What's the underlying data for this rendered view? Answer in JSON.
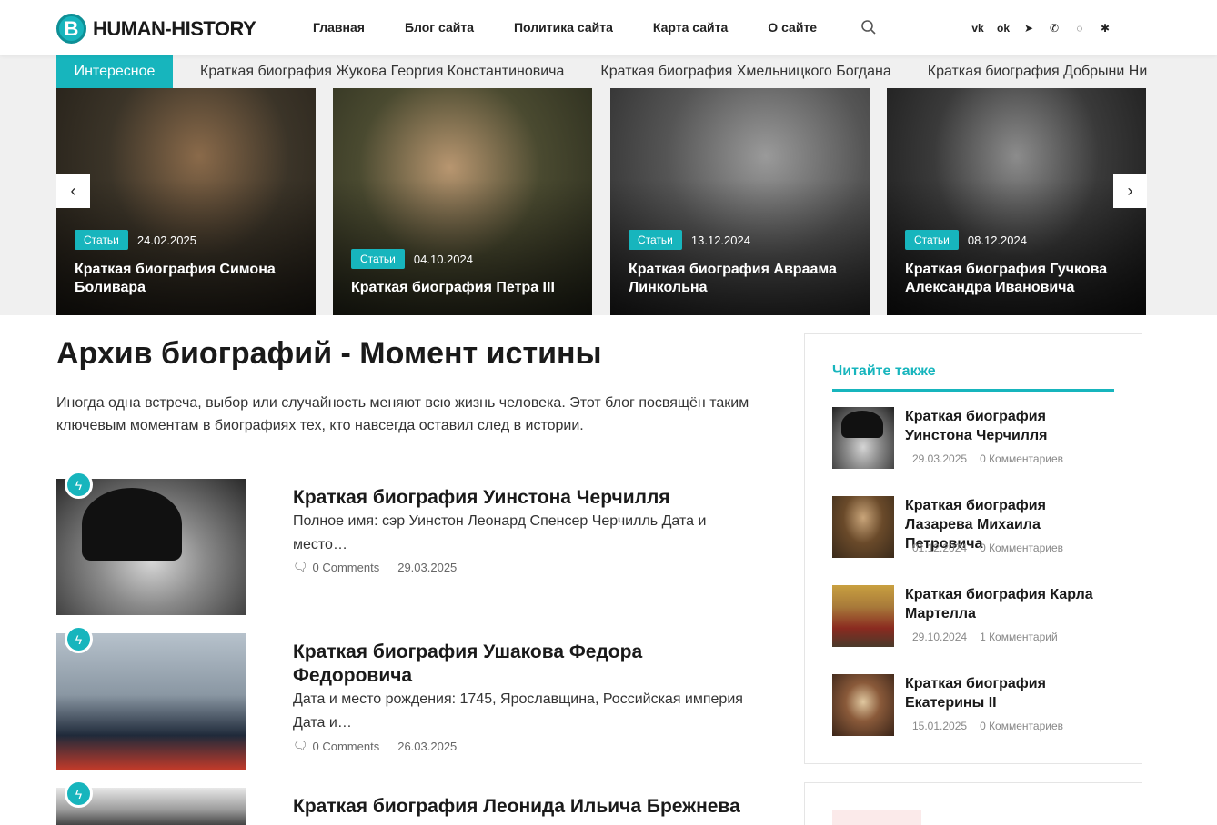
{
  "header": {
    "logo_mark": "B",
    "logo_text": "HUMAN-HISTORY",
    "nav": [
      "Главная",
      "Блог сайта",
      "Политика сайта",
      "Карта сайта",
      "О сайте"
    ],
    "social_icons": [
      "vk-icon",
      "ok-icon",
      "telegram-icon",
      "viber-icon",
      "whatsapp-icon",
      "zen-icon"
    ]
  },
  "ticker": {
    "label": "Интересное",
    "items": [
      "Краткая биография Жукова Георгия Константиновича",
      "Краткая биография Хмельницкого Богдана",
      "Краткая биография Добрыни Никитича"
    ]
  },
  "slider": {
    "prev": "‹",
    "next": "›",
    "slides": [
      {
        "badge": "Статьи",
        "date": "24.02.2025",
        "title": "Краткая биография Симона Боливара",
        "bg": "#3b3428"
      },
      {
        "badge": "Статьи",
        "date": "04.10.2024",
        "title": "Краткая биография Петра III",
        "bg": "#4a4a30"
      },
      {
        "badge": "Статьи",
        "date": "13.12.2024",
        "title": "Краткая биография Авраама Линкольна",
        "bg": "#555555"
      },
      {
        "badge": "Статьи",
        "date": "08.12.2024",
        "title": "Краткая биография Гучкова Александра Ивановича",
        "bg": "#2e2e2e"
      }
    ]
  },
  "main": {
    "title": "Архив биографий - Момент истины",
    "intro": "Иногда одна встреча, выбор или случайность меняют всю жизнь человека. Этот блог посвящён таким ключевым моментам в биографиях тех, кто навсегда оставил след в истории.",
    "posts": [
      {
        "title": "Краткая биография Уинстона Черчилля",
        "excerpt": "Полное имя: сэр Уинстон Леонард Спенсер Черчилль Дата и место…",
        "comments": "0 Comments",
        "date": "29.03.2025"
      },
      {
        "title": "Краткая биография Ушакова Федора Федоровича",
        "excerpt": "Дата и место рождения: 1745, Ярославщина, Российская империя Дата и…",
        "comments": "0 Comments",
        "date": "26.03.2025"
      },
      {
        "title": "Краткая биография Леонида Ильича Брежнева",
        "excerpt": "",
        "comments": "",
        "date": ""
      }
    ]
  },
  "sidebar": {
    "heading": "Читайте также",
    "items": [
      {
        "title": "Краткая биография Уинстона Черчилля",
        "date": "29.03.2025",
        "comments": "0 Комментариев"
      },
      {
        "title": "Краткая биография Лазарева Михаила Петровича",
        "date": "01.12.2024",
        "comments": "0 Комментариев"
      },
      {
        "title": "Краткая биография Карла Мартелла",
        "date": "29.10.2024",
        "comments": "1 Комментарий"
      },
      {
        "title": "Краткая биография Екатерины II",
        "date": "15.01.2025",
        "comments": "0 Комментариев"
      }
    ]
  },
  "colors": {
    "accent": "#17b5bd"
  }
}
